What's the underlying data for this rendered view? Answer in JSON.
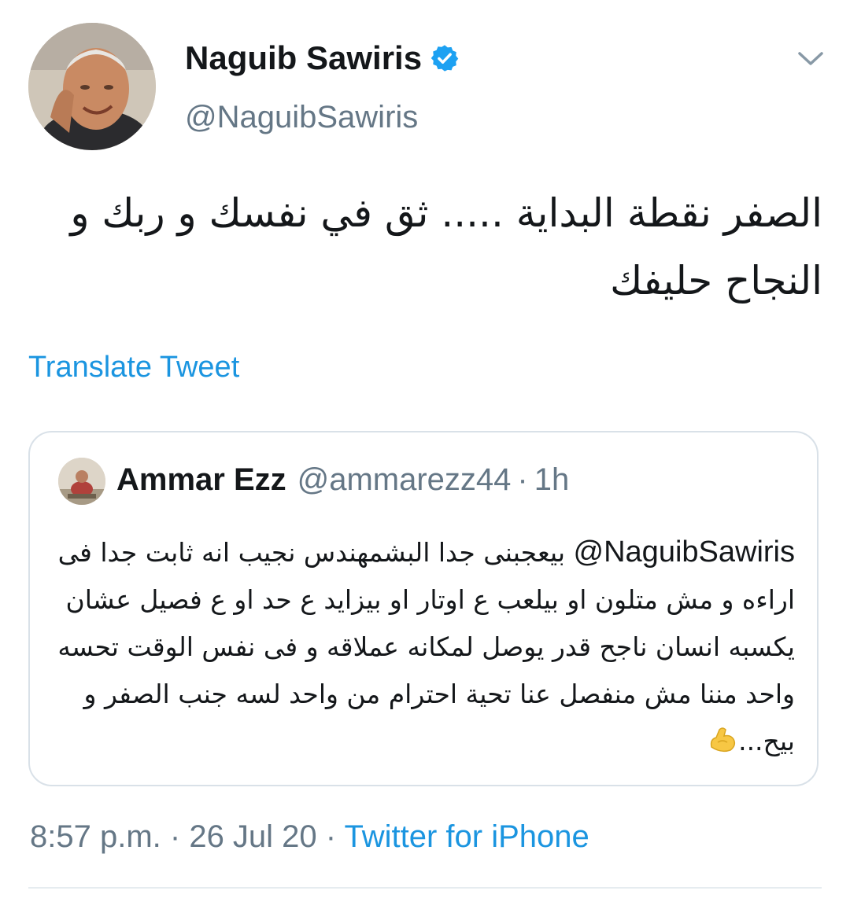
{
  "author": {
    "name": "Naguib Sawiris",
    "handle": "@NaguibSawiris",
    "verified": true
  },
  "tweet": {
    "text": "الصفر نقطة البداية ..... ثق في نفسك و ربك و النجاح حليفك",
    "translate_label": "Translate Tweet"
  },
  "quoted_tweet": {
    "name": "Ammar Ezz",
    "handle": "@ammarezz44",
    "time": "1h",
    "mention": "@NaguibSawiris",
    "text": "بيعجبنى جدا البشمهندس نجيب انه ثابت جدا فى اراءه و مش متلون او بيلعب ع اوتار او بيزايد ع حد او ع فصيل عشان يكسبه انسان ناجح قدر يوصل لمكانه عملاقه و فى نفس الوقت تحسه واحد مننا مش منفصل عنا تحية احترام من واحد لسه جنب الصفر و بيح...",
    "emoji_icon": "flexed-biceps-emoji"
  },
  "meta": {
    "time": "8:57 p.m.",
    "date": "26 Jul 20",
    "source": "Twitter for iPhone"
  },
  "colors": {
    "link": "#1b95e0",
    "secondary_text": "#657786",
    "primary_text": "#14171a",
    "border": "#d9e1e8"
  }
}
